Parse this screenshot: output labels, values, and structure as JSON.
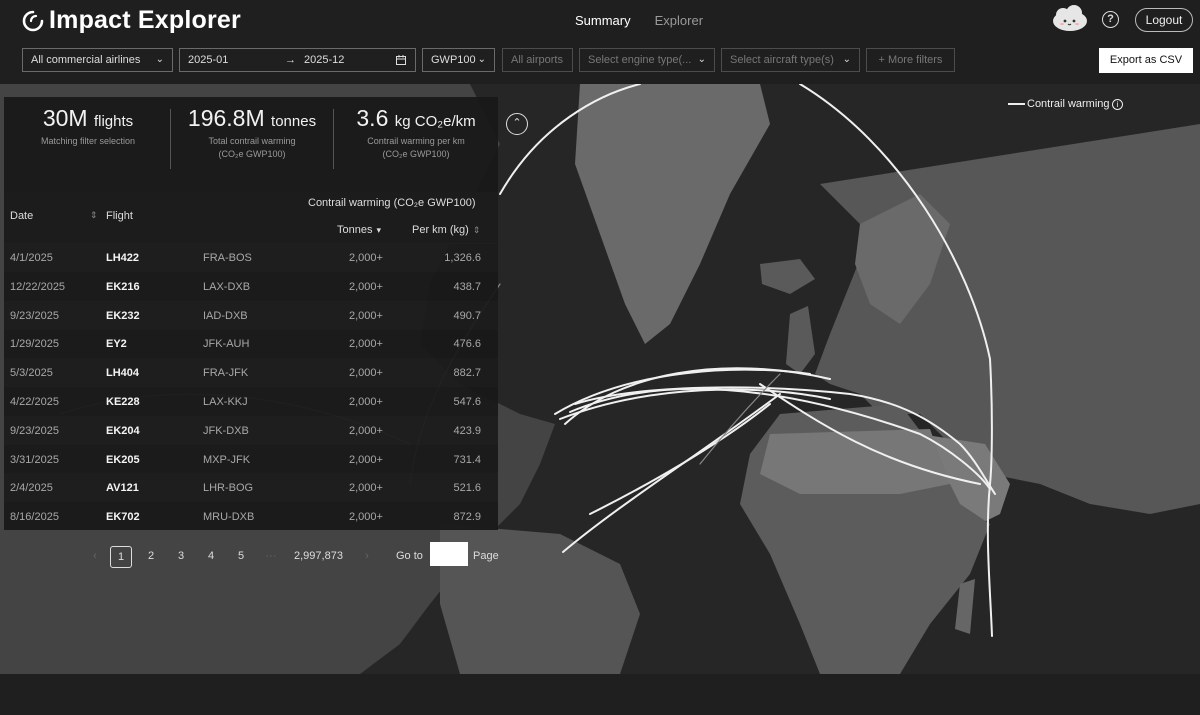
{
  "app": {
    "title": "Impact Explorer"
  },
  "nav": {
    "summary": "Summary",
    "explorer": "Explorer"
  },
  "header": {
    "logout": "Logout",
    "help": "?"
  },
  "filters": {
    "airlines": "All commercial airlines",
    "date_from": "2025-01",
    "date_arrow": "→",
    "date_to": "2025-12",
    "metric": "GWP100",
    "airports": "All airports",
    "engine": "Select engine type(...",
    "aircraft": "Select aircraft type(s)",
    "more": "+ More filters",
    "export": "Export as CSV"
  },
  "legend": {
    "label": "Contrail warming",
    "info": "i"
  },
  "stats": [
    {
      "value": "30M",
      "unit": "flights",
      "sub1": "Matching filter selection",
      "sub2": ""
    },
    {
      "value": "196.8M",
      "unit": "tonnes",
      "sub1": "Total contrail warming",
      "sub2": "(CO₂e GWP100)"
    },
    {
      "value": "3.6",
      "unit": "kg CO₂e/km",
      "sub1": "Contrail warming per km",
      "sub2": "(CO₂e GWP100)"
    }
  ],
  "table": {
    "headers": {
      "date": "Date",
      "flight": "Flight",
      "group": "Contrail warming (CO₂e GWP100)",
      "tonnes": "Tonnes",
      "perkm": "Per km (kg)"
    },
    "rows": [
      {
        "date": "4/1/2025",
        "flight": "LH422",
        "route": "FRA-BOS",
        "tonnes": "2,000+",
        "perkm": "1,326.6"
      },
      {
        "date": "12/22/2025",
        "flight": "EK216",
        "route": "LAX-DXB",
        "tonnes": "2,000+",
        "perkm": "438.7"
      },
      {
        "date": "9/23/2025",
        "flight": "EK232",
        "route": "IAD-DXB",
        "tonnes": "2,000+",
        "perkm": "490.7"
      },
      {
        "date": "1/29/2025",
        "flight": "EY2",
        "route": "JFK-AUH",
        "tonnes": "2,000+",
        "perkm": "476.6"
      },
      {
        "date": "5/3/2025",
        "flight": "LH404",
        "route": "FRA-JFK",
        "tonnes": "2,000+",
        "perkm": "882.7"
      },
      {
        "date": "4/22/2025",
        "flight": "KE228",
        "route": "LAX-KKJ",
        "tonnes": "2,000+",
        "perkm": "547.6"
      },
      {
        "date": "9/23/2025",
        "flight": "EK204",
        "route": "JFK-DXB",
        "tonnes": "2,000+",
        "perkm": "423.9"
      },
      {
        "date": "3/31/2025",
        "flight": "EK205",
        "route": "MXP-JFK",
        "tonnes": "2,000+",
        "perkm": "731.4"
      },
      {
        "date": "2/4/2025",
        "flight": "AV121",
        "route": "LHR-BOG",
        "tonnes": "2,000+",
        "perkm": "521.6"
      },
      {
        "date": "8/16/2025",
        "flight": "EK702",
        "route": "MRU-DXB",
        "tonnes": "2,000+",
        "perkm": "872.9"
      }
    ]
  },
  "pagination": {
    "prev": "‹",
    "pages": [
      "1",
      "2",
      "3",
      "4",
      "5"
    ],
    "ellipsis": "···",
    "last": "2,997,873",
    "next": "›",
    "goto_label": "Go to",
    "page_label": "Page",
    "goto_value": ""
  },
  "colors": {
    "accent": "#ffffff",
    "background": "#1f1f1f",
    "land": "#4a4a4a",
    "ocean": "#262626"
  }
}
